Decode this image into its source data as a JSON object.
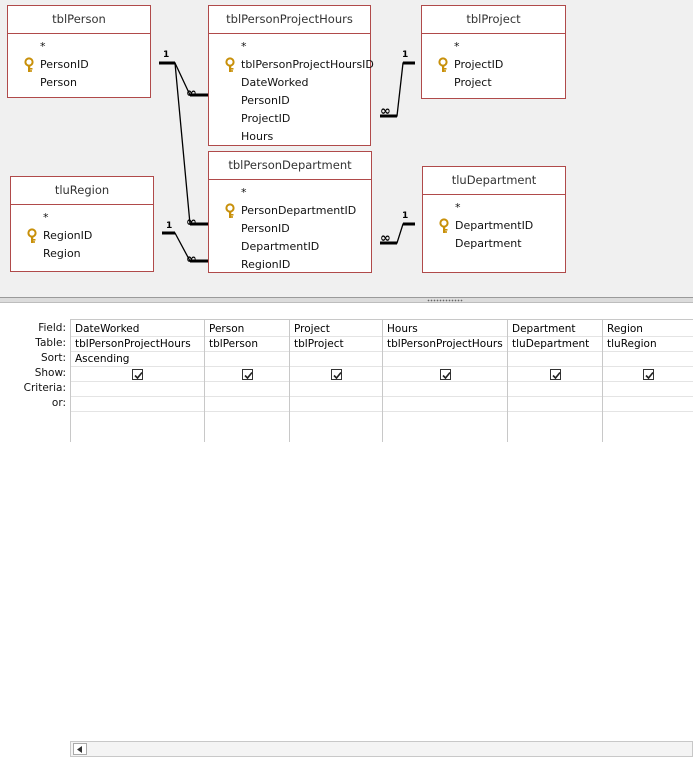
{
  "tables": [
    {
      "id": "tblPerson",
      "title": "tblPerson",
      "fields": [
        {
          "name": "*",
          "key": false
        },
        {
          "name": "PersonID",
          "key": true
        },
        {
          "name": "Person",
          "key": false
        }
      ]
    },
    {
      "id": "tblPersonProjectHours",
      "title": "tblPersonProjectHours",
      "fields": [
        {
          "name": "*",
          "key": false
        },
        {
          "name": "tblPersonProjectHoursID",
          "key": true
        },
        {
          "name": "DateWorked",
          "key": false
        },
        {
          "name": "PersonID",
          "key": false
        },
        {
          "name": "ProjectID",
          "key": false
        },
        {
          "name": "Hours",
          "key": false
        }
      ]
    },
    {
      "id": "tblProject",
      "title": "tblProject",
      "fields": [
        {
          "name": "*",
          "key": false
        },
        {
          "name": "ProjectID",
          "key": true
        },
        {
          "name": "Project",
          "key": false
        }
      ]
    },
    {
      "id": "tluRegion",
      "title": "tluRegion",
      "fields": [
        {
          "name": "*",
          "key": false
        },
        {
          "name": "RegionID",
          "key": true
        },
        {
          "name": "Region",
          "key": false
        }
      ]
    },
    {
      "id": "tblPersonDepartment",
      "title": "tblPersonDepartment",
      "fields": [
        {
          "name": "*",
          "key": false
        },
        {
          "name": "PersonDepartmentID",
          "key": true
        },
        {
          "name": "PersonID",
          "key": false
        },
        {
          "name": "DepartmentID",
          "key": false
        },
        {
          "name": "RegionID",
          "key": false
        }
      ]
    },
    {
      "id": "tluDepartment",
      "title": "tluDepartment",
      "fields": [
        {
          "name": "*",
          "key": false
        },
        {
          "name": "DepartmentID",
          "key": true
        },
        {
          "name": "Department",
          "key": false
        }
      ]
    }
  ],
  "relationship_labels": {
    "one": "1",
    "many": "∞"
  },
  "grid": {
    "row_labels": {
      "field": "Field:",
      "table": "Table:",
      "sort": "Sort:",
      "show": "Show:",
      "criteria": "Criteria:",
      "or": "or:"
    },
    "columns": [
      {
        "field": "DateWorked",
        "table": "tblPersonProjectHours",
        "sort": "Ascending",
        "show": true
      },
      {
        "field": "Person",
        "table": "tblPerson",
        "sort": "",
        "show": true
      },
      {
        "field": "Project",
        "table": "tblProject",
        "sort": "",
        "show": true
      },
      {
        "field": "Hours",
        "table": "tblPersonProjectHours",
        "sort": "",
        "show": true
      },
      {
        "field": "Department",
        "table": "tluDepartment",
        "sort": "",
        "show": true
      },
      {
        "field": "Region",
        "table": "tluRegion",
        "sort": "",
        "show": true
      }
    ]
  },
  "colors": {
    "table_border": "#b04a4a",
    "key_icon": "#d4a017",
    "design_bg": "#f0f0f0"
  }
}
